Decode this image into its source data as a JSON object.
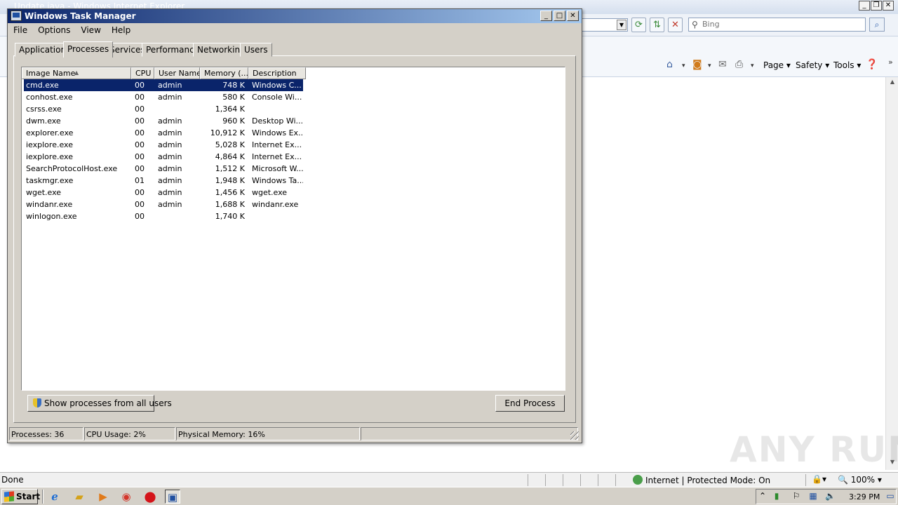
{
  "ie": {
    "title": "Update java - Windows Internet Explorer",
    "search_placeholder": "Bing",
    "command_bar": {
      "page_label": "Page",
      "safety_label": "Safety",
      "tools_label": "Tools"
    },
    "status": {
      "text": "Done",
      "zone": "Internet | Protected Mode: On",
      "zoom": "100%"
    }
  },
  "task_manager": {
    "title": "Windows Task Manager",
    "menu": [
      "File",
      "Options",
      "View",
      "Help"
    ],
    "tabs": [
      "Applications",
      "Processes",
      "Services",
      "Performance",
      "Networking",
      "Users"
    ],
    "active_tab": "Processes",
    "columns": {
      "name": "Image Name",
      "cpu": "CPU",
      "user": "User Name",
      "memory": "Memory (...",
      "description": "Description"
    },
    "processes": [
      {
        "name": "cmd.exe",
        "cpu": "00",
        "user": "admin",
        "memory": "748 K",
        "description": "Windows C..."
      },
      {
        "name": "conhost.exe",
        "cpu": "00",
        "user": "admin",
        "memory": "580 K",
        "description": "Console Wi..."
      },
      {
        "name": "csrss.exe",
        "cpu": "00",
        "user": "",
        "memory": "1,364 K",
        "description": ""
      },
      {
        "name": "dwm.exe",
        "cpu": "00",
        "user": "admin",
        "memory": "960 K",
        "description": "Desktop Wi..."
      },
      {
        "name": "explorer.exe",
        "cpu": "00",
        "user": "admin",
        "memory": "10,912 K",
        "description": "Windows Ex..."
      },
      {
        "name": "iexplore.exe",
        "cpu": "00",
        "user": "admin",
        "memory": "5,028 K",
        "description": "Internet Ex..."
      },
      {
        "name": "iexplore.exe",
        "cpu": "00",
        "user": "admin",
        "memory": "4,864 K",
        "description": "Internet Ex..."
      },
      {
        "name": "SearchProtocolHost.exe",
        "cpu": "00",
        "user": "admin",
        "memory": "1,512 K",
        "description": "Microsoft W..."
      },
      {
        "name": "taskmgr.exe",
        "cpu": "01",
        "user": "admin",
        "memory": "1,948 K",
        "description": "Windows Ta..."
      },
      {
        "name": "wget.exe",
        "cpu": "00",
        "user": "admin",
        "memory": "1,456 K",
        "description": "wget.exe"
      },
      {
        "name": "windanr.exe",
        "cpu": "00",
        "user": "admin",
        "memory": "1,688 K",
        "description": "windanr.exe"
      },
      {
        "name": "winlogon.exe",
        "cpu": "00",
        "user": "",
        "memory": "1,740 K",
        "description": ""
      }
    ],
    "selected_index": 0,
    "show_all_label": "Show processes from all users",
    "end_process_label": "End Process",
    "status": {
      "processes": "Processes: 36",
      "cpu": "CPU Usage: 2%",
      "memory": "Physical Memory: 16%"
    }
  },
  "taskbar": {
    "start_label": "Start",
    "clock": "3:29 PM"
  },
  "watermark": "ANY RUN",
  "colors": {
    "selection": "#0a246a",
    "title_gradient_start": "#0a246a",
    "title_gradient_end": "#a6caf0",
    "window_face": "#d4d0c8"
  }
}
